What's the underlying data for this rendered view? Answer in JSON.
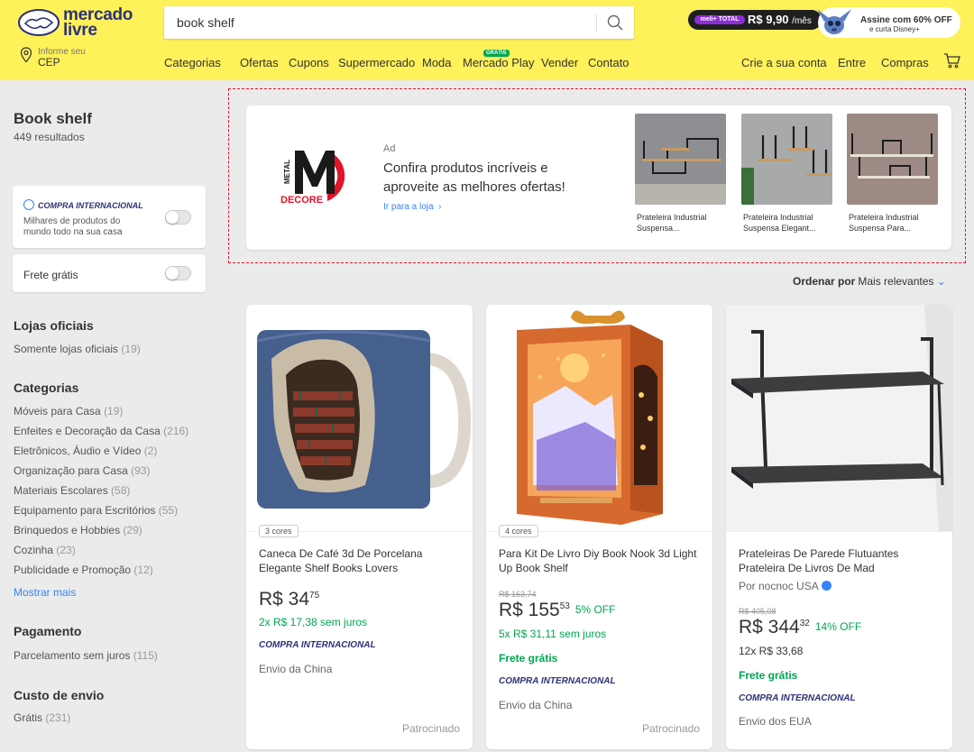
{
  "header": {
    "logo_line1": "mercado",
    "logo_line2": "livre",
    "cep_small": "Informe seu",
    "cep_big": "CEP",
    "search_value": "book shelf",
    "promo": {
      "meli_tag": "meli+ TOTAL",
      "price": "R$ 9,90",
      "per": "/mês",
      "line1": "Assine com 60% OFF",
      "line2": "e curta Disney+"
    },
    "nav": [
      "Categorias",
      "Ofertas",
      "Cupons",
      "Supermercado",
      "Moda",
      "Mercado Play",
      "Vender",
      "Contato"
    ],
    "gratis_tag": "GRÁTIS",
    "account": [
      "Crie a sua conta",
      "Entre",
      "Compras"
    ],
    "colors": {
      "bar": "#fff159",
      "brand": "#2d3277"
    }
  },
  "sidebar": {
    "title": "Book shelf",
    "count": "449 resultados",
    "intl_title": "COMPRA INTERNACIONAL",
    "intl_desc": "Milhares de produtos do mundo todo na sua casa",
    "frete": "Frete grátis",
    "lojas_title": "Lojas oficiais",
    "lojas_item": "Somente lojas oficiais",
    "lojas_count": "(19)",
    "cat_title": "Categorias",
    "categories": [
      {
        "name": "Móveis para Casa",
        "count": "(19)"
      },
      {
        "name": "Enfeites e Decoração da Casa",
        "count": "(216)"
      },
      {
        "name": "Eletrônicos, Áudio e Vídeo",
        "count": "(2)"
      },
      {
        "name": "Organização para Casa",
        "count": "(93)"
      },
      {
        "name": "Materiais Escolares",
        "count": "(58)"
      },
      {
        "name": "Equipamento para Escritórios",
        "count": "(55)"
      },
      {
        "name": "Brinquedos e Hobbies",
        "count": "(29)"
      },
      {
        "name": "Cozinha",
        "count": "(23)"
      },
      {
        "name": "Publicidade e Promoção",
        "count": "(12)"
      }
    ],
    "show_more": "Mostrar mais",
    "pay_title": "Pagamento",
    "pay_item": "Parcelamento sem juros",
    "pay_count": "(115)",
    "ship_title": "Custo de envio",
    "ship_item": "Grátis",
    "ship_count": "(231)"
  },
  "ad": {
    "tag": "Ad",
    "headline": "Confira produtos incríveis e aproveite as melhores ofertas!",
    "link": "Ir para a loja",
    "products": [
      {
        "caption": "Prateleira Industrial Suspensa..."
      },
      {
        "caption": "Prateleira Industrial Suspensa Elegant..."
      },
      {
        "caption": "Prateleira Industrial Suspensa Para..."
      }
    ]
  },
  "sort": {
    "label": "Ordenar por",
    "value": "Mais relevantes"
  },
  "products": [
    {
      "colors": "3 cores",
      "title": "Caneca De Café 3d De Porcelana Elegante Shelf Books Lovers",
      "price_int": "R$ 34",
      "price_cents": "75",
      "installments": "2x R$ 17,38 sem juros",
      "intl": "COMPRA INTERNACIONAL",
      "ship": "Envio da China",
      "sponsored": "Patrocinado"
    },
    {
      "colors": "4 cores",
      "title": "Para Kit De Livro Diy Book Nook 3d Light Up Book Shelf",
      "old_price": "R$ 163,74",
      "price_int": "R$ 155",
      "price_cents": "53",
      "off": "5% OFF",
      "installments": "5x R$ 31,11 sem juros",
      "free": "Frete grátis",
      "intl": "COMPRA INTERNACIONAL",
      "ship": "Envio da China",
      "sponsored": "Patrocinado"
    },
    {
      "title": "Prateleiras De Parede Flutuantes Prateleira De Livros De Mad",
      "seller": "Por nocnoc USA",
      "old_price": "R$ 405,08",
      "price_int": "R$ 344",
      "price_cents": "32",
      "off": "14% OFF",
      "installments": "12x R$ 33,68",
      "free": "Frete grátis",
      "intl": "COMPRA INTERNACIONAL",
      "ship": "Envio dos EUA"
    }
  ]
}
